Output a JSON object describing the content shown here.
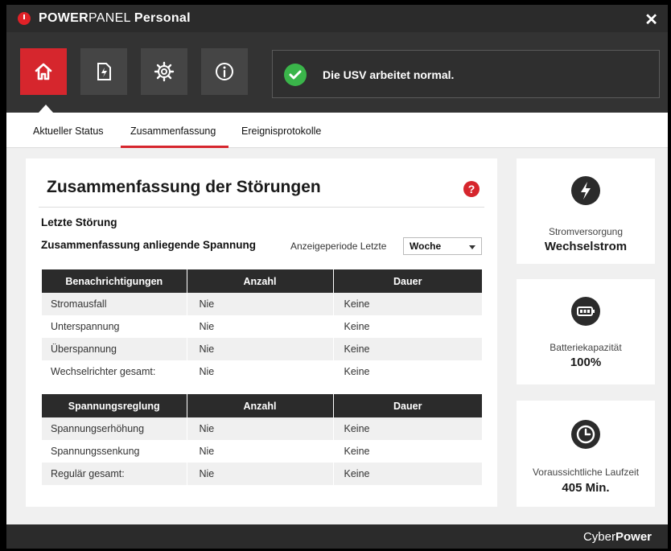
{
  "titlebar": {
    "brand_bold": "POWER",
    "brand_rest": "PANEL",
    "edition": "Personal",
    "close": "✕"
  },
  "toolbar": {
    "buttons": [
      {
        "icon": "home-icon",
        "active": true
      },
      {
        "icon": "power-document-icon",
        "active": false
      },
      {
        "icon": "gear-icon",
        "active": false
      },
      {
        "icon": "info-icon",
        "active": false
      }
    ],
    "status_text": "Die USV arbeitet normal.",
    "status_color": "#3ab54a"
  },
  "tabs": [
    "Aktueller Status",
    "Zusammenfassung",
    "Ereignisprotokolle"
  ],
  "active_tab": 1,
  "summary": {
    "title": "Zusammenfassung der Störungen",
    "help": "?",
    "last_fault_heading": "Letzte Störung",
    "voltage_heading": "Zusammenfassung anliegende Spannung",
    "period_label": "Anzeigeperiode Letzte",
    "period_value": "Woche",
    "table1": {
      "headers": [
        "Benachrichtigungen",
        "Anzahl",
        "Dauer"
      ],
      "rows": [
        [
          "Stromausfall",
          "Nie",
          "Keine"
        ],
        [
          "Unterspannung",
          "Nie",
          "Keine"
        ],
        [
          "Überspannung",
          "Nie",
          "Keine"
        ],
        [
          "Wechselrichter gesamt:",
          "Nie",
          "Keine"
        ]
      ]
    },
    "table2": {
      "headers": [
        "Spannungsreglung",
        "Anzahl",
        "Dauer"
      ],
      "rows": [
        [
          "Spannungserhöhung",
          "Nie",
          "Keine"
        ],
        [
          "Spannungssenkung",
          "Nie",
          "Keine"
        ],
        [
          "Regulär gesamt:",
          "Nie",
          "Keine"
        ]
      ]
    }
  },
  "side": [
    {
      "icon": "lightning-icon",
      "label": "Stromversorgung",
      "value": "Wechselstrom"
    },
    {
      "icon": "battery-icon",
      "label": "Batteriekapazität",
      "value": "100%"
    },
    {
      "icon": "clock-icon",
      "label": "Voraussichtliche Laufzeit",
      "value": "405 Min."
    }
  ],
  "footer": {
    "brand_bold": "Cyber",
    "brand_rest": "Power"
  },
  "colors": {
    "accent": "#d6262d",
    "dark": "#2b2b2b",
    "toolbar": "#333333",
    "ok": "#3ab54a"
  }
}
